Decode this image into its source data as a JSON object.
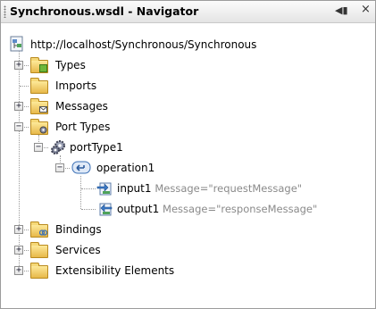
{
  "window": {
    "title": "Synchronous.wsdl - Navigator",
    "minimize_glyph": "◀▮",
    "close_glyph": "×"
  },
  "tree": {
    "root": "http://localhost/Synchronous/Synchronous",
    "types": "Types",
    "imports": "Imports",
    "messages": "Messages",
    "port_types": "Port Types",
    "port_type1": "portType1",
    "operation1": "operation1",
    "input1": {
      "name": "input1",
      "attr": "Message=\"requestMessage\""
    },
    "output1": {
      "name": "output1",
      "attr": "Message=\"responseMessage\""
    },
    "bindings": "Bindings",
    "services": "Services",
    "extensibility": "Extensibility Elements"
  },
  "icons": {
    "root": "wsdl-document-icon",
    "folder": "folder-icon",
    "porttype": "gear-icon",
    "operation": "operation-icon",
    "input": "input-arrow-icon",
    "output": "output-arrow-icon"
  },
  "colors": {
    "attribute": "#8a8a8a",
    "folder": "#f0c96a",
    "operation": "#3a6fb5"
  }
}
